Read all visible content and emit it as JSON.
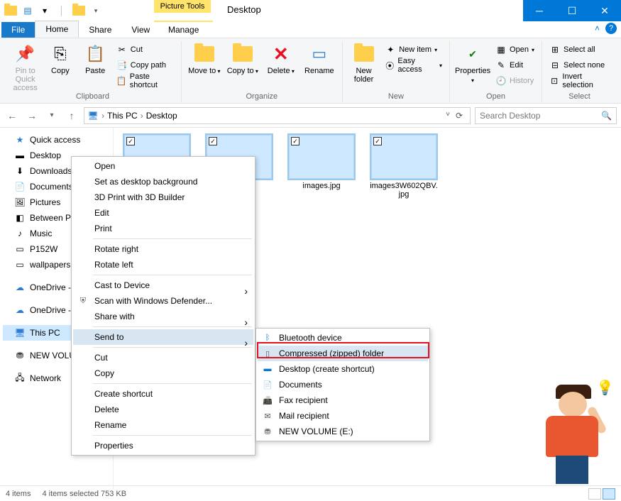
{
  "window": {
    "title": "Desktop"
  },
  "qat": {
    "dropdown": "▾"
  },
  "ctx_tab": {
    "label": "Picture Tools"
  },
  "tabs": {
    "file": "File",
    "home": "Home",
    "share": "Share",
    "view": "View",
    "manage": "Manage"
  },
  "ribbon": {
    "pin": "Pin to Quick access",
    "copy": "Copy",
    "paste": "Paste",
    "cut": "Cut",
    "copy_path": "Copy path",
    "paste_shortcut": "Paste shortcut",
    "clipboard_group": "Clipboard",
    "move_to": "Move to",
    "copy_to": "Copy to",
    "delete": "Delete",
    "rename": "Rename",
    "organize_group": "Organize",
    "new_folder": "New folder",
    "new_item": "New item",
    "easy_access": "Easy access",
    "new_group": "New",
    "properties": "Properties",
    "open": "Open",
    "edit": "Edit",
    "history": "History",
    "open_group": "Open",
    "select_all": "Select all",
    "select_none": "Select none",
    "invert_selection": "Invert selection",
    "select_group": "Select"
  },
  "nav": {
    "this_pc": "This PC",
    "desktop": "Desktop",
    "search_placeholder": "Search Desktop"
  },
  "sidebar": {
    "items": [
      {
        "label": "Quick access",
        "icon": "★"
      },
      {
        "label": "Desktop",
        "icon": "▬"
      },
      {
        "label": "Downloads",
        "icon": "⬇"
      },
      {
        "label": "Documents",
        "icon": "📄"
      },
      {
        "label": "Pictures",
        "icon": "🖼"
      },
      {
        "label": "Between P",
        "icon": "◧"
      },
      {
        "label": "Music",
        "icon": "♪"
      },
      {
        "label": "P152W",
        "icon": "▭"
      },
      {
        "label": "wallpapers",
        "icon": "▭"
      },
      {
        "label": "OneDrive -",
        "icon": "☁"
      },
      {
        "label": "OneDrive -",
        "icon": "☁"
      },
      {
        "label": "This PC",
        "icon": "🖥"
      },
      {
        "label": "NEW VOLUM",
        "icon": "⛃"
      },
      {
        "label": "Network",
        "icon": "🖧"
      }
    ]
  },
  "thumbs": [
    {
      "label": ""
    },
    {
      "label": ""
    },
    {
      "label": "images.jpg"
    },
    {
      "label": "images3W602QBV.jpg"
    }
  ],
  "ctx_primary": [
    {
      "t": "Open"
    },
    {
      "t": "Set as desktop background"
    },
    {
      "t": "3D Print with 3D Builder"
    },
    {
      "t": "Edit"
    },
    {
      "t": "Print"
    },
    {
      "sep": true
    },
    {
      "t": "Rotate right"
    },
    {
      "t": "Rotate left"
    },
    {
      "sep": true
    },
    {
      "t": "Cast to Device",
      "sub": true
    },
    {
      "t": "Scan with Windows Defender...",
      "ico": "⛨"
    },
    {
      "t": "Share with",
      "sub": true
    },
    {
      "sep": true
    },
    {
      "t": "Send to",
      "sub": true,
      "hl": true
    },
    {
      "sep": true
    },
    {
      "t": "Cut"
    },
    {
      "t": "Copy"
    },
    {
      "sep": true
    },
    {
      "t": "Create shortcut"
    },
    {
      "t": "Delete"
    },
    {
      "t": "Rename"
    },
    {
      "sep": true
    },
    {
      "t": "Properties"
    }
  ],
  "ctx_secondary": [
    {
      "t": "Bluetooth device",
      "ico": "ᛒ",
      "c": "#0078d7"
    },
    {
      "t": "Compressed (zipped) folder",
      "ico": "▯",
      "hl": true
    },
    {
      "t": "Desktop (create shortcut)",
      "ico": "▬",
      "c": "#0078d7"
    },
    {
      "t": "Documents",
      "ico": "📄"
    },
    {
      "t": "Fax recipient",
      "ico": "📠"
    },
    {
      "t": "Mail recipient",
      "ico": "✉"
    },
    {
      "t": "NEW VOLUME (E:)",
      "ico": "⛃"
    }
  ],
  "status": {
    "count": "4 items",
    "selection": "4 items selected  753 KB"
  }
}
